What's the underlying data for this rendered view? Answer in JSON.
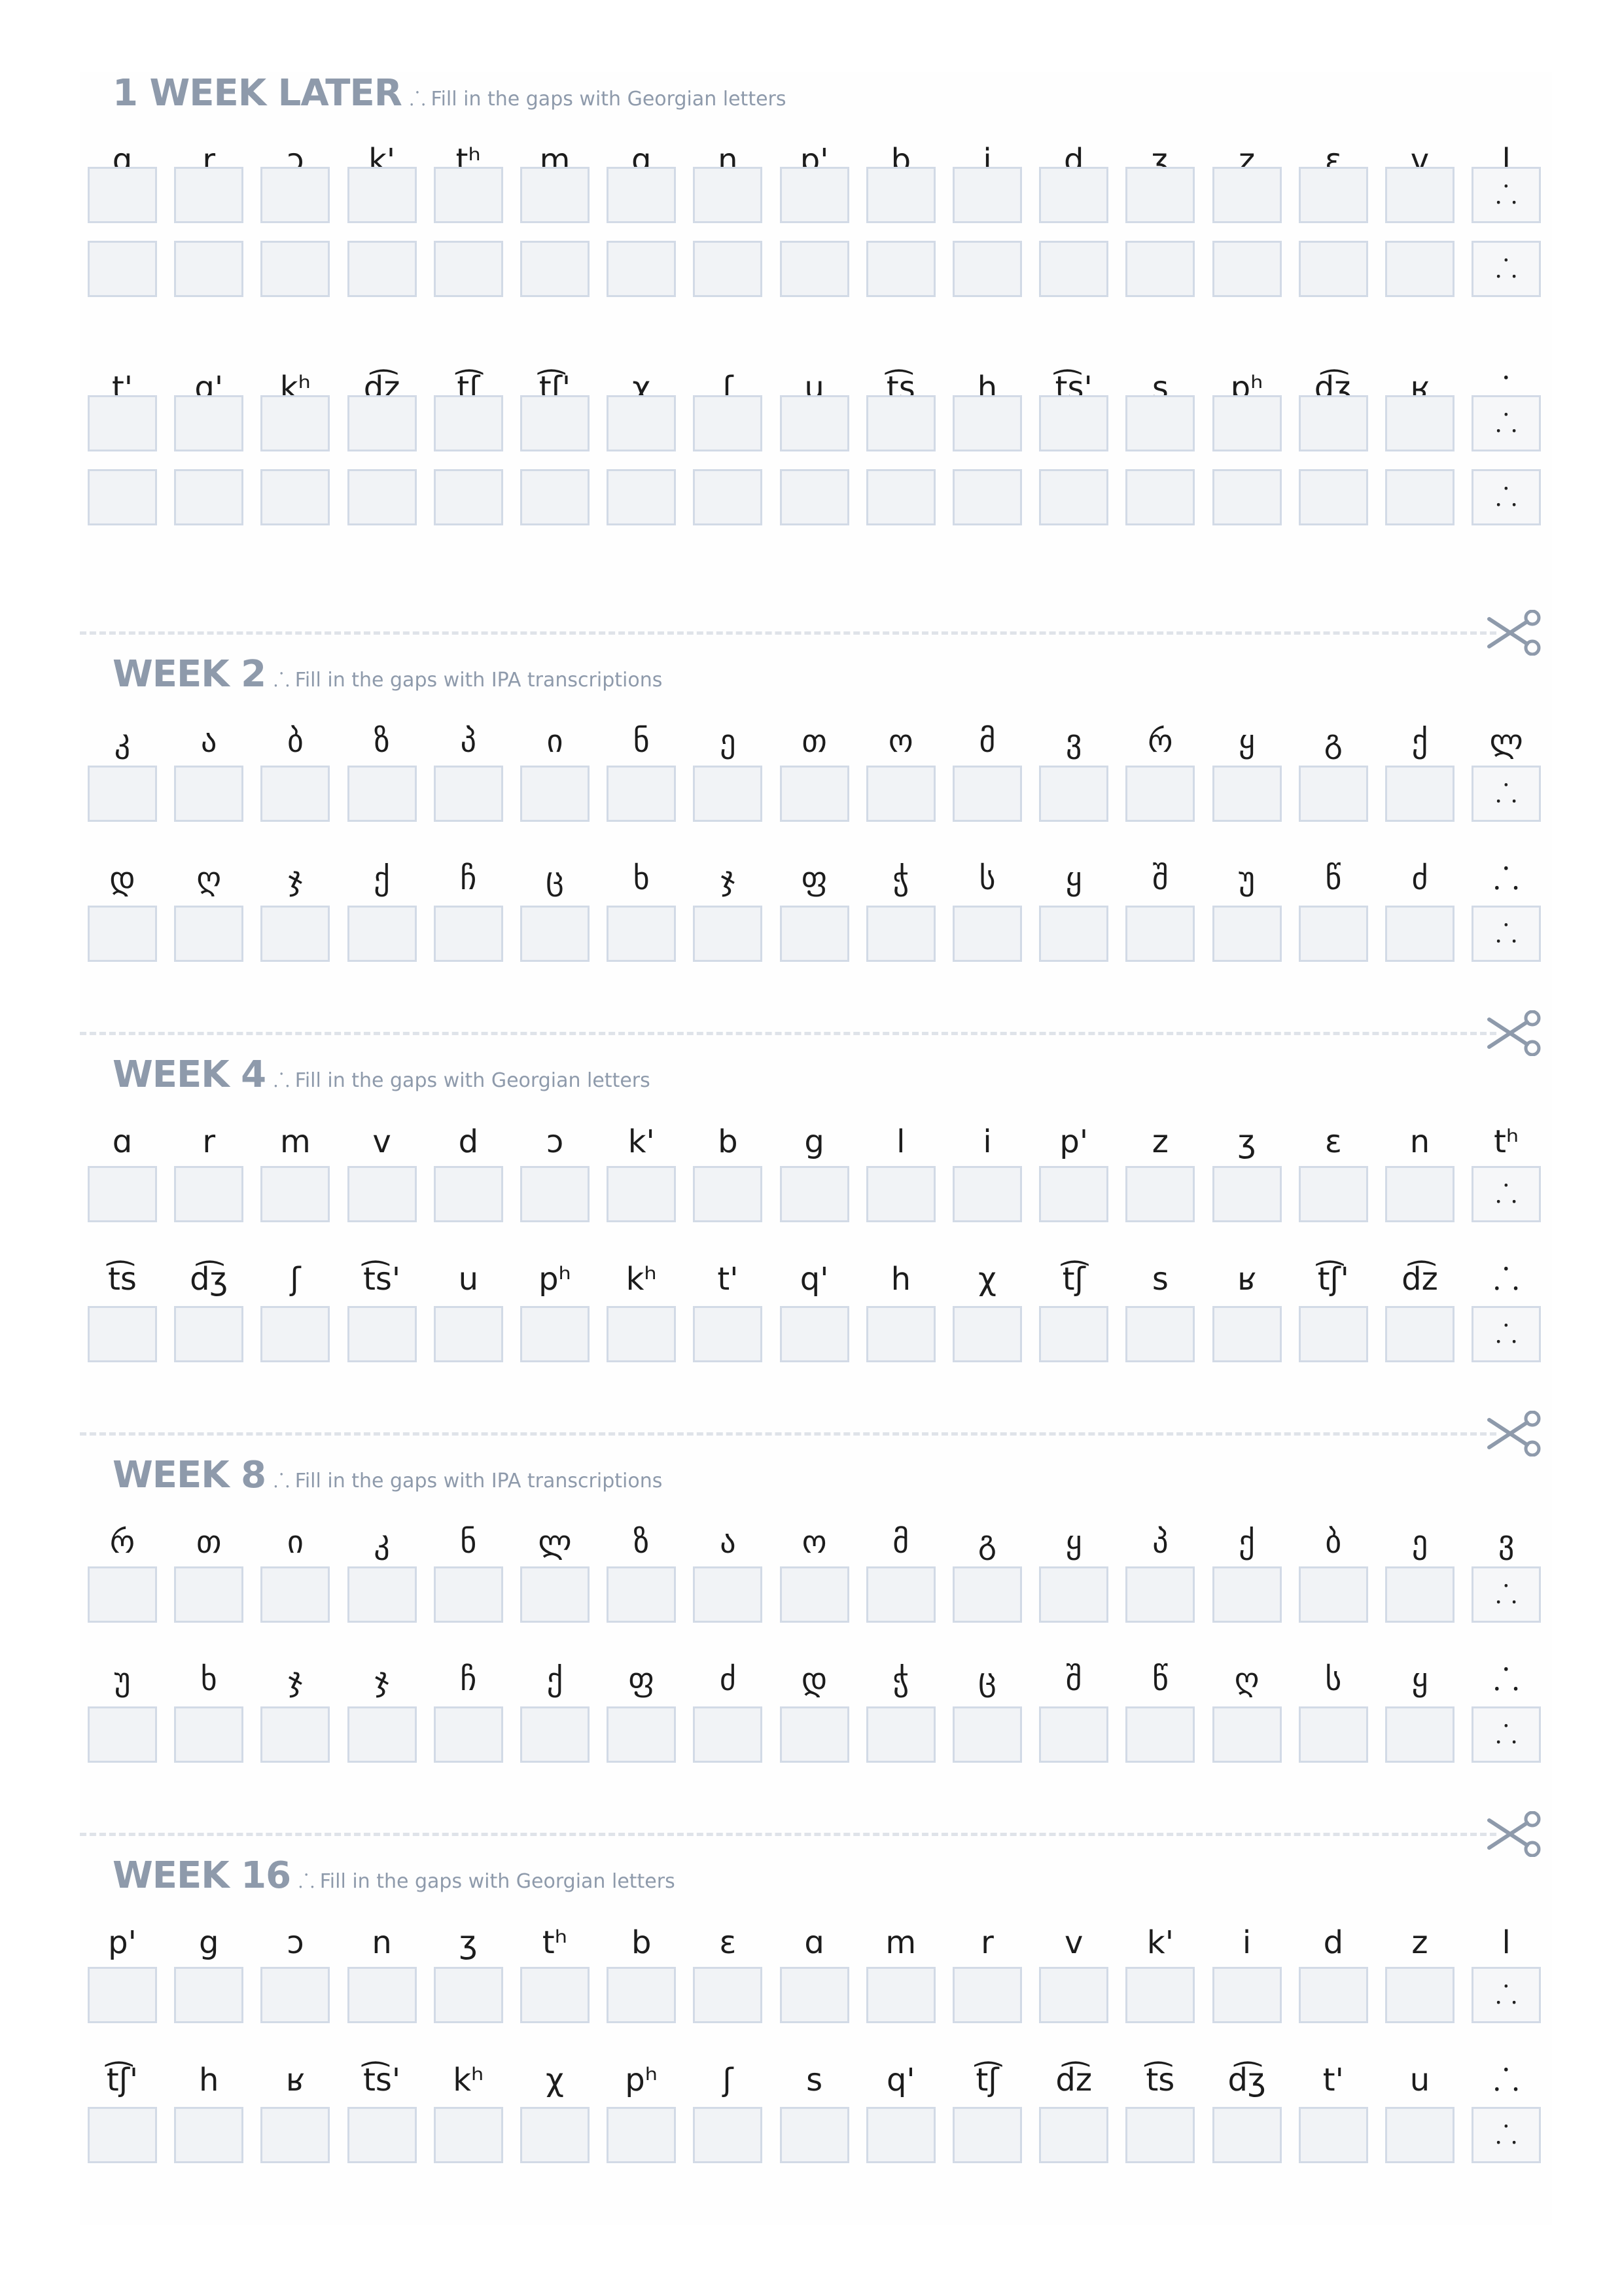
{
  "sections": [
    {
      "title": "1 WEEK LATER",
      "separator": "⸫",
      "subtitle": "Fill in the gaps with Georgian letters",
      "row1_labels": [
        "ɑ",
        "r",
        "ɔ",
        "k'",
        "tʰ",
        "m",
        "g",
        "n",
        "p'",
        "b",
        "i",
        "d",
        "ʒ",
        "z",
        "ɛ",
        "v",
        "l"
      ],
      "row2_labels": [
        "t'",
        "q'",
        "kʰ",
        "d͡z",
        "t͡ʃ",
        "t͡ʃ'",
        "χ",
        "ʃ",
        "u",
        "t͡s",
        "h",
        "t͡s'",
        "s",
        "pʰ",
        "d͡ʒ",
        "ʁ",
        "⸫"
      ],
      "box_marker": "⸫"
    },
    {
      "title": "WEEK 2",
      "separator": "⸫",
      "subtitle": "Fill in the gaps with IPA transcriptions",
      "row1_labels": [
        "კ",
        "ა",
        "ბ",
        "ზ",
        "პ",
        "ი",
        "ნ",
        "ე",
        "თ",
        "ო",
        "მ",
        "ვ",
        "რ",
        "ყ",
        "გ",
        "ქ",
        "ლ"
      ],
      "row2_labels": [
        "დ",
        "ღ",
        "ჯ",
        "ქ",
        "ჩ",
        "ც",
        "ხ",
        "ჯ",
        "ფ",
        "ჭ",
        "ს",
        "ყ",
        "შ",
        "უ",
        "წ",
        "ძ",
        "⸫"
      ],
      "box_marker": "⸫"
    },
    {
      "title": "WEEK 4",
      "separator": "⸫",
      "subtitle": "Fill in the gaps with Georgian letters",
      "row1_labels": [
        "ɑ",
        "r",
        "m",
        "v",
        "d",
        "ɔ",
        "k'",
        "b",
        "g",
        "l",
        "i",
        "p'",
        "z",
        "ʒ",
        "ɛ",
        "n",
        "tʰ"
      ],
      "row2_labels": [
        "t͡s",
        "d͡ʒ",
        "ʃ",
        "t͡s'",
        "u",
        "pʰ",
        "kʰ",
        "t'",
        "q'",
        "h",
        "χ",
        "t͡ʃ",
        "s",
        "ʁ",
        "t͡ʃ'",
        "d͡z",
        "⸫"
      ],
      "box_marker": "⸫"
    },
    {
      "title": "WEEK 8",
      "separator": "⸫",
      "subtitle": "Fill in the gaps with IPA transcriptions",
      "row1_labels": [
        "რ",
        "თ",
        "ი",
        "კ",
        "ნ",
        "ლ",
        "ზ",
        "ა",
        "ო",
        "მ",
        "გ",
        "ყ",
        "პ",
        "ქ",
        "ბ",
        "ე",
        "ვ"
      ],
      "row2_labels": [
        "უ",
        "ხ",
        "ჯ",
        "ჯ",
        "ჩ",
        "ქ",
        "ფ",
        "ძ",
        "დ",
        "ჭ",
        "ც",
        "შ",
        "წ",
        "ღ",
        "ს",
        "ყ",
        "⸫"
      ],
      "box_marker": "⸫"
    },
    {
      "title": "WEEK 16",
      "separator": "⸫",
      "subtitle": "Fill in the gaps with Georgian letters",
      "row1_labels": [
        "p'",
        "g",
        "ɔ",
        "n",
        "ʒ",
        "tʰ",
        "b",
        "ɛ",
        "ɑ",
        "m",
        "r",
        "v",
        "k'",
        "i",
        "d",
        "z",
        "l"
      ],
      "row2_labels": [
        "t͡ʃ'",
        "h",
        "ʁ",
        "t͡s'",
        "kʰ",
        "χ",
        "pʰ",
        "ʃ",
        "s",
        "q'",
        "t͡ʃ",
        "d͡z",
        "t͡s",
        "d͡ʒ",
        "t'",
        "u",
        "⸫"
      ],
      "box_marker": "⸫"
    }
  ],
  "colors": {
    "heading": "#8e9aab",
    "box_fill": "#f1f3f6",
    "box_border": "#d2dae6",
    "cut_line": "#dfe3e9",
    "scissors": "#8e9aab"
  },
  "icons": {
    "cut_marker": "scissors-icon"
  }
}
